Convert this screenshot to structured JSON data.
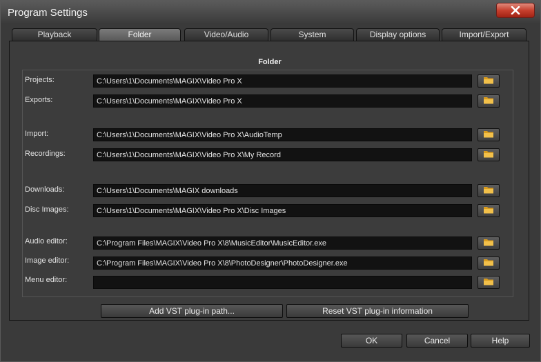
{
  "window": {
    "title": "Program Settings"
  },
  "tabs": [
    {
      "label": "Playback",
      "active": false
    },
    {
      "label": "Folder",
      "active": true
    },
    {
      "label": "Video/Audio",
      "active": false
    },
    {
      "label": "System",
      "active": false
    },
    {
      "label": "Display options",
      "active": false
    },
    {
      "label": "Import/Export",
      "active": false
    }
  ],
  "section": {
    "title": "Folder"
  },
  "rows": [
    {
      "label": "Projects:",
      "value": "C:\\Users\\1\\Documents\\MAGIX\\Video Pro X"
    },
    {
      "label": "Exports:",
      "value": "C:\\Users\\1\\Documents\\MAGIX\\Video Pro X"
    },
    {
      "label": "Import:",
      "value": "C:\\Users\\1\\Documents\\MAGIX\\Video Pro X\\AudioTemp"
    },
    {
      "label": "Recordings:",
      "value": "C:\\Users\\1\\Documents\\MAGIX\\Video Pro X\\My Record"
    },
    {
      "label": "Downloads:",
      "value": "C:\\Users\\1\\Documents\\MAGIX downloads"
    },
    {
      "label": "Disc Images:",
      "value": "C:\\Users\\1\\Documents\\MAGIX\\Video Pro X\\Disc Images"
    },
    {
      "label": "Audio editor:",
      "value": "C:\\Program Files\\MAGIX\\Video Pro X\\8\\MusicEditor\\MusicEditor.exe"
    },
    {
      "label": "Image editor:",
      "value": "C:\\Program Files\\MAGIX\\Video Pro X\\8\\PhotoDesigner\\PhotoDesigner.exe"
    },
    {
      "label": "Menu editor:",
      "value": ""
    }
  ],
  "vst": {
    "add_label": "Add VST plug-in path...",
    "reset_label": "Reset VST plug-in information"
  },
  "footer": {
    "ok_label": "OK",
    "cancel_label": "Cancel",
    "help_label": "Help"
  },
  "colors": {
    "close_button": "#c7402e",
    "folder_icon": "#e8b032",
    "field_bg": "#121212"
  },
  "icons": {
    "close": "close-icon",
    "folder": "folder-icon"
  }
}
